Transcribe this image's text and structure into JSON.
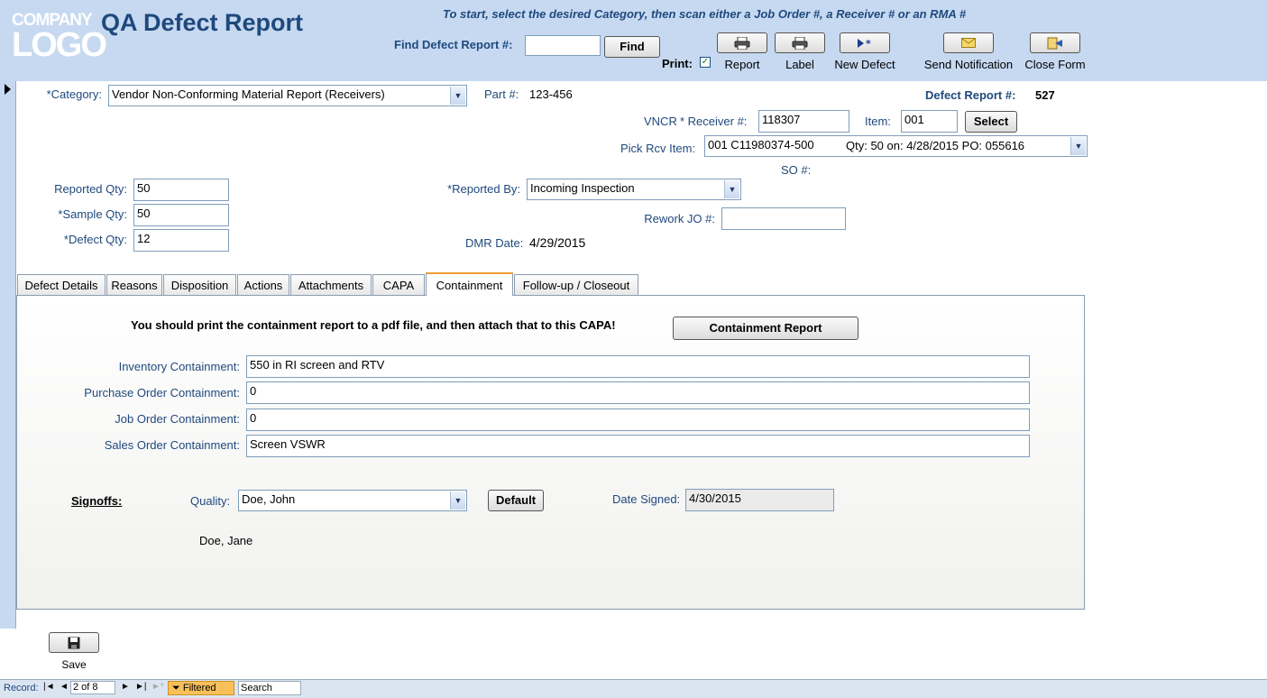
{
  "header": {
    "logo_line1": "COMPANY",
    "logo_line2": "LOGO",
    "title": "QA Defect Report",
    "instruction": "To start, select the desired Category, then scan either a Job Order #, a Receiver # or an RMA #",
    "find_label": "Find Defect Report #:",
    "find_value": "",
    "find_button": "Find",
    "print_label": "Print:",
    "print_checked": true,
    "toolbar": [
      {
        "label": "Report",
        "icon": "printer-icon"
      },
      {
        "label": "Label",
        "icon": "printer-icon"
      },
      {
        "label": "New Defect",
        "icon": "new-record-icon"
      },
      {
        "label": "Send Notification",
        "icon": "envelope-icon"
      },
      {
        "label": "Close Form",
        "icon": "close-form-icon"
      }
    ]
  },
  "form": {
    "category_label": "*Category:",
    "category_value": "Vendor Non-Conforming Material Report (Receivers)",
    "part_label": "Part #:",
    "part_value": "123-456",
    "defect_report_label": "Defect Report #:",
    "defect_report_value": "527",
    "vncr_label": "VNCR",
    "receiver_label": "* Receiver #:",
    "receiver_value": "118307",
    "item_label": "Item:",
    "item_value": "001",
    "select_button": "Select",
    "pick_rcv_label": "Pick Rcv Item:",
    "pick_rcv_value": "001 C11980374-500",
    "pick_rcv_detail": "Qty: 50 on: 4/28/2015 PO: 055616",
    "so_label": "SO #:",
    "reported_qty_label": "Reported Qty:",
    "reported_qty_value": "50",
    "sample_qty_label": "*Sample Qty:",
    "sample_qty_value": "50",
    "defect_qty_label": "*Defect Qty:",
    "defect_qty_value": "12",
    "reported_by_label": "*Reported By:",
    "reported_by_value": "Incoming Inspection",
    "rework_label": "Rework JO #:",
    "rework_value": "",
    "dmr_label": "DMR Date:",
    "dmr_value": "4/29/2015"
  },
  "tabs": [
    {
      "label": "Defect Details"
    },
    {
      "label": "Reasons"
    },
    {
      "label": "Disposition"
    },
    {
      "label": "Actions"
    },
    {
      "label": "Attachments"
    },
    {
      "label": "CAPA"
    },
    {
      "label": "Containment",
      "active": true
    },
    {
      "label": "Follow-up / Closeout"
    }
  ],
  "containment": {
    "note": "You should print the containment report to a pdf file, and then attach that to this CAPA!",
    "report_button": "Containment Report",
    "inventory_label": "Inventory Containment:",
    "inventory_value": "550  in RI   screen and RTV",
    "po_label": "Purchase Order Containment:",
    "po_value": "0",
    "jo_label": "Job Order Containment:",
    "jo_value": "0",
    "so_label": "Sales Order Containment:",
    "so_value": "Screen VSWR",
    "signoffs_label": "Signoffs:",
    "quality_label": "Quality:",
    "quality_value": "Doe, John",
    "default_button": "Default",
    "date_signed_label": "Date Signed:",
    "date_signed_value": "4/30/2015",
    "secondary_signer": "Doe, Jane"
  },
  "footer": {
    "save_label": "Save"
  },
  "statusbar": {
    "record_label": "Record:",
    "record_value": "2 of 8",
    "filtered_label": "Filtered",
    "search_label": "Search"
  }
}
